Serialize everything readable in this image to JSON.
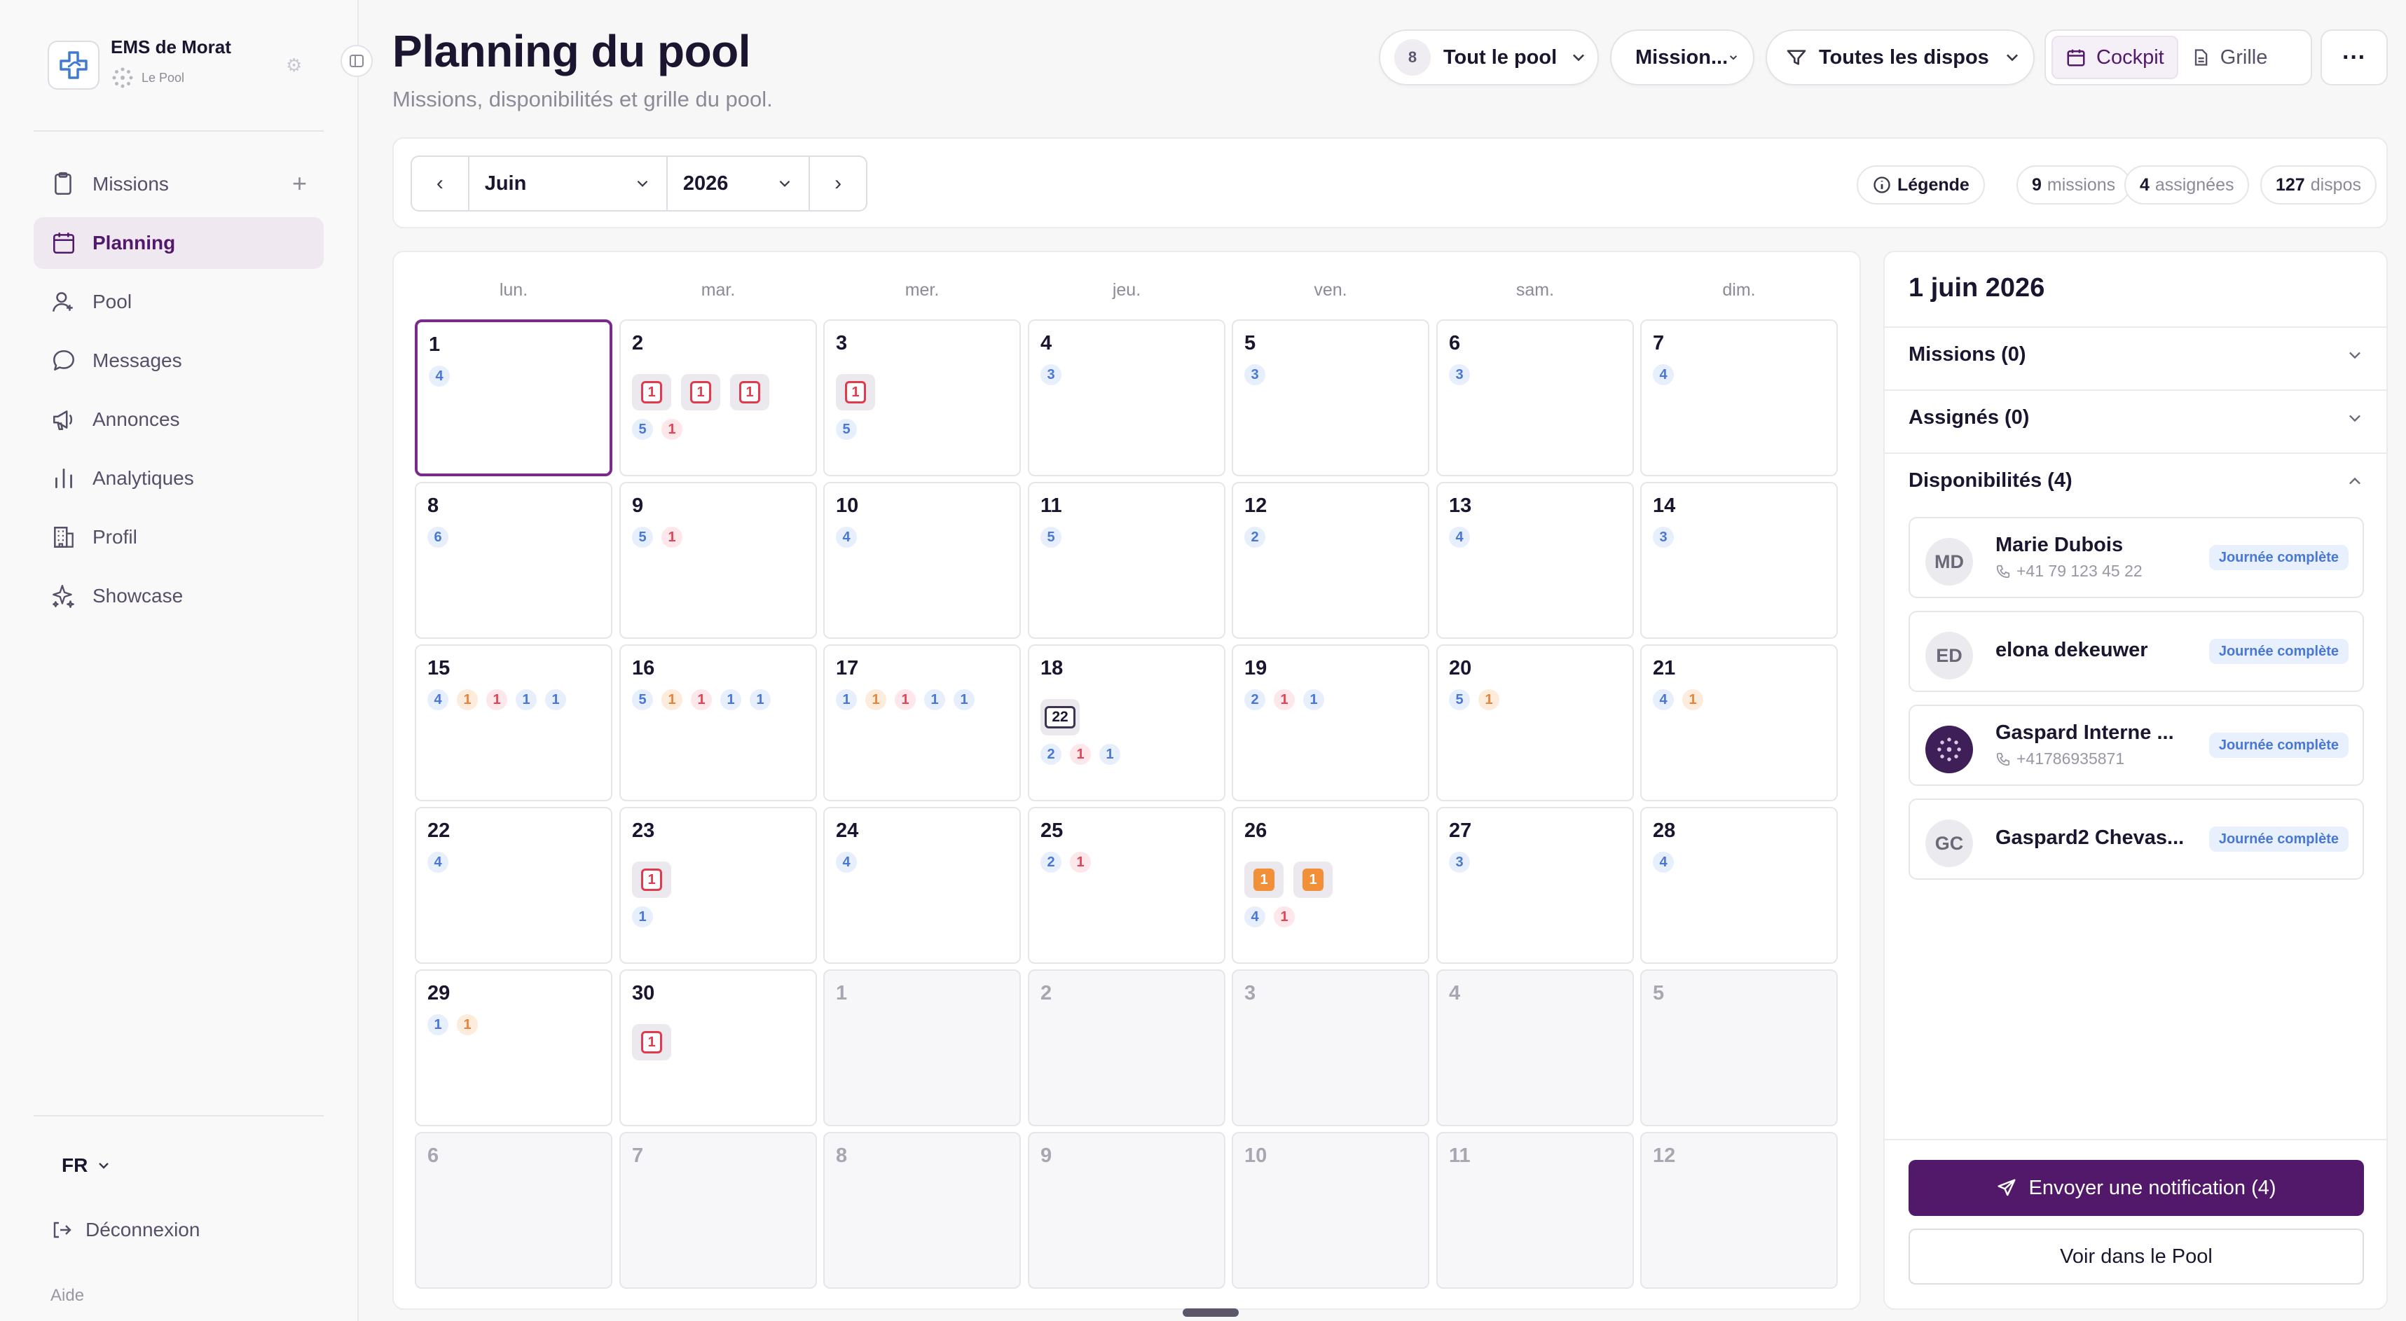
{
  "org": {
    "name": "EMS de Morat",
    "pool_label": "Le Pool"
  },
  "nav": [
    {
      "label": "Missions",
      "icon": "clipboard-icon",
      "plus": "+"
    },
    {
      "label": "Planning",
      "icon": "calendar-icon",
      "active": true
    },
    {
      "label": "Pool",
      "icon": "user-icon"
    },
    {
      "label": "Messages",
      "icon": "chat-icon"
    },
    {
      "label": "Annonces",
      "icon": "megaphone-icon"
    },
    {
      "label": "Analytiques",
      "icon": "bar-chart-icon"
    },
    {
      "label": "Profil",
      "icon": "building-icon"
    },
    {
      "label": "Showcase",
      "icon": "sparkles-icon"
    }
  ],
  "footer": {
    "lang": "FR",
    "logout": "Déconnexion",
    "help": "Aide"
  },
  "header": {
    "title": "Planning du pool",
    "subtitle": "Missions, disponibilités et grille du pool.",
    "pool_count": "8",
    "pool_filter": "Tout le pool",
    "mission_filter": "Mission...",
    "dispo_filter": "Toutes les dispos",
    "view_cockpit": "Cockpit",
    "view_grille": "Grille",
    "more": "···"
  },
  "toolbar": {
    "prev": "‹",
    "next": "›",
    "month": "Juin",
    "year": "2026",
    "legend": "Légende",
    "missions_count": "9",
    "missions_label": "missions",
    "assigned_count": "4",
    "assigned_label": "assignées",
    "dispos_count": "127",
    "dispos_label": "dispos"
  },
  "calendar": {
    "weekdays": [
      "lun.",
      "mar.",
      "mer.",
      "jeu.",
      "ven.",
      "sam.",
      "dim."
    ],
    "days": [
      {
        "d": "1",
        "sel": true,
        "badges": [
          [
            "4",
            "blue"
          ]
        ]
      },
      {
        "d": "2",
        "missions": [
          [
            "1",
            "red"
          ],
          [
            "1",
            "red"
          ],
          [
            "1",
            "red"
          ]
        ],
        "badges": [
          [
            "5",
            "blue"
          ],
          [
            "1",
            "red"
          ]
        ]
      },
      {
        "d": "3",
        "missions": [
          [
            "1",
            "red"
          ]
        ],
        "badges": [
          [
            "5",
            "blue"
          ]
        ]
      },
      {
        "d": "4",
        "badges": [
          [
            "3",
            "blue"
          ]
        ]
      },
      {
        "d": "5",
        "badges": [
          [
            "3",
            "blue"
          ]
        ]
      },
      {
        "d": "6",
        "badges": [
          [
            "3",
            "blue"
          ]
        ]
      },
      {
        "d": "7",
        "badges": [
          [
            "4",
            "blue"
          ]
        ]
      },
      {
        "d": "8",
        "badges": [
          [
            "6",
            "blue"
          ]
        ]
      },
      {
        "d": "9",
        "badges": [
          [
            "5",
            "blue"
          ],
          [
            "1",
            "red"
          ]
        ]
      },
      {
        "d": "10",
        "badges": [
          [
            "4",
            "blue"
          ]
        ]
      },
      {
        "d": "11",
        "badges": [
          [
            "5",
            "blue"
          ]
        ]
      },
      {
        "d": "12",
        "badges": [
          [
            "2",
            "blue"
          ]
        ]
      },
      {
        "d": "13",
        "badges": [
          [
            "4",
            "blue"
          ]
        ]
      },
      {
        "d": "14",
        "badges": [
          [
            "3",
            "blue"
          ]
        ]
      },
      {
        "d": "15",
        "badges": [
          [
            "4",
            "blue"
          ],
          [
            "1",
            "org"
          ],
          [
            "1",
            "red"
          ],
          [
            "1",
            "blue"
          ],
          [
            "1",
            "blue"
          ]
        ]
      },
      {
        "d": "16",
        "badges": [
          [
            "5",
            "blue"
          ],
          [
            "1",
            "org"
          ],
          [
            "1",
            "red"
          ],
          [
            "1",
            "blue"
          ],
          [
            "1",
            "blue"
          ]
        ]
      },
      {
        "d": "17",
        "badges": [
          [
            "1",
            "blue"
          ],
          [
            "1",
            "org"
          ],
          [
            "1",
            "red"
          ],
          [
            "1",
            "blue"
          ],
          [
            "1",
            "blue"
          ]
        ]
      },
      {
        "d": "18",
        "missions": [
          [
            "22",
            "dark"
          ]
        ],
        "badges": [
          [
            "2",
            "blue"
          ],
          [
            "1",
            "red"
          ],
          [
            "1",
            "blue"
          ]
        ]
      },
      {
        "d": "19",
        "badges": [
          [
            "2",
            "blue"
          ],
          [
            "1",
            "red"
          ],
          [
            "1",
            "blue"
          ]
        ]
      },
      {
        "d": "20",
        "badges": [
          [
            "5",
            "blue"
          ],
          [
            "1",
            "org"
          ]
        ]
      },
      {
        "d": "21",
        "badges": [
          [
            "4",
            "blue"
          ],
          [
            "1",
            "org"
          ]
        ]
      },
      {
        "d": "22",
        "badges": [
          [
            "4",
            "blue"
          ]
        ]
      },
      {
        "d": "23",
        "missions": [
          [
            "1",
            "red"
          ]
        ],
        "badges": [
          [
            "1",
            "blue"
          ]
        ]
      },
      {
        "d": "24",
        "badges": [
          [
            "4",
            "blue"
          ]
        ]
      },
      {
        "d": "25",
        "badges": [
          [
            "2",
            "blue"
          ],
          [
            "1",
            "red"
          ]
        ]
      },
      {
        "d": "26",
        "missions": [
          [
            "1",
            "orange"
          ],
          [
            "1",
            "orange"
          ]
        ],
        "badges": [
          [
            "4",
            "blue"
          ],
          [
            "1",
            "red"
          ]
        ]
      },
      {
        "d": "27",
        "badges": [
          [
            "3",
            "blue"
          ]
        ]
      },
      {
        "d": "28",
        "badges": [
          [
            "4",
            "blue"
          ]
        ]
      },
      {
        "d": "29",
        "badges": [
          [
            "1",
            "blue"
          ],
          [
            "1",
            "org"
          ]
        ]
      },
      {
        "d": "30",
        "missions": [
          [
            "1",
            "red"
          ]
        ]
      },
      {
        "d": "1",
        "out": true
      },
      {
        "d": "2",
        "out": true
      },
      {
        "d": "3",
        "out": true
      },
      {
        "d": "4",
        "out": true
      },
      {
        "d": "5",
        "out": true
      },
      {
        "d": "6",
        "out": true
      },
      {
        "d": "7",
        "out": true
      },
      {
        "d": "8",
        "out": true
      },
      {
        "d": "9",
        "out": true
      },
      {
        "d": "10",
        "out": true
      },
      {
        "d": "11",
        "out": true
      },
      {
        "d": "12",
        "out": true
      }
    ]
  },
  "panel": {
    "date": "1 juin 2026",
    "missions": "Missions (0)",
    "assigned": "Assignés (0)",
    "dispos": "Disponibilités (4)",
    "people": [
      {
        "initials": "MD",
        "name": "Marie Dubois",
        "phone": "+41 79 123 45 22",
        "tag": "Journée complète"
      },
      {
        "initials": "ED",
        "name": "elona dekeuwer",
        "phone": "",
        "tag": "Journée complète"
      },
      {
        "initials": "",
        "name": "Gaspard Interne ...",
        "phone": "+41786935871",
        "tag": "Journée complète",
        "img": true
      },
      {
        "initials": "GC",
        "name": "Gaspard2 Chevas...",
        "phone": "",
        "tag": "Journée complète"
      }
    ],
    "notify": "Envoyer une notification (4)",
    "view_pool": "Voir dans le Pool"
  },
  "colors": {
    "brand": "#52196a",
    "accent_bg": "#efe8f1",
    "blue_badge": "#4877d6",
    "red_badge": "#de4658",
    "orange_mission": "#f28f39"
  }
}
